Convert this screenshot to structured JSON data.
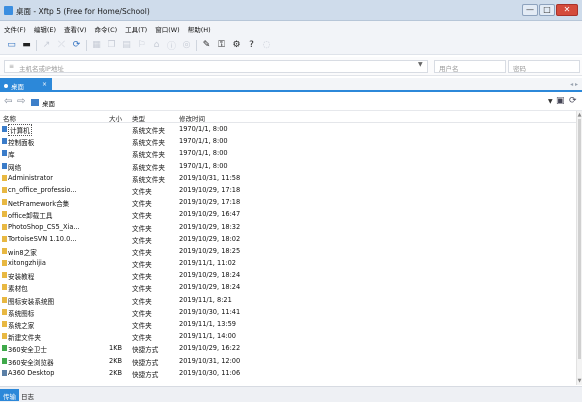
{
  "window": {
    "title": "桌面 - Xftp 5 (Free for Home/School)",
    "btn_min": "—",
    "btn_max": "□",
    "btn_close": "✕"
  },
  "menu": [
    "文件(F)",
    "编辑(E)",
    "查看(V)",
    "命令(C)",
    "工具(T)",
    "窗口(W)",
    "帮助(H)"
  ],
  "address": {
    "placeholder": "主机名或IP地址",
    "username_placeholder": "用户名",
    "password_placeholder": "密码"
  },
  "tab": {
    "label": "桌面",
    "close": "×"
  },
  "path": {
    "location": "桌面"
  },
  "columns": {
    "name": "名称",
    "size": "大小",
    "type": "类型",
    "date": "修改时间"
  },
  "files": [
    {
      "name": "计算机",
      "size": "",
      "type": "系统文件夹",
      "date": "1970/1/1, 8:00",
      "icon_color": "#3a7cc9"
    },
    {
      "name": "控制面板",
      "size": "",
      "type": "系统文件夹",
      "date": "1970/1/1, 8:00",
      "icon_color": "#3a7cc9"
    },
    {
      "name": "库",
      "size": "",
      "type": "系统文件夹",
      "date": "1970/1/1, 8:00",
      "icon_color": "#3a7cc9"
    },
    {
      "name": "网络",
      "size": "",
      "type": "系统文件夹",
      "date": "1970/1/1, 8:00",
      "icon_color": "#3a7cc9"
    },
    {
      "name": "Administrator",
      "size": "",
      "type": "系统文件夹",
      "date": "2019/10/31, 11:58",
      "icon_color": "#e8b842"
    },
    {
      "name": "cn_office_professio...",
      "size": "",
      "type": "文件夹",
      "date": "2019/10/29, 17:18",
      "icon_color": "#e8b842"
    },
    {
      "name": "NetFramework合集",
      "size": "",
      "type": "文件夹",
      "date": "2019/10/29, 17:18",
      "icon_color": "#e8b842"
    },
    {
      "name": "office卸载工具",
      "size": "",
      "type": "文件夹",
      "date": "2019/10/29, 16:47",
      "icon_color": "#e8b842"
    },
    {
      "name": "PhotoShop_CS5_Xia...",
      "size": "",
      "type": "文件夹",
      "date": "2019/10/29, 18:32",
      "icon_color": "#e8b842"
    },
    {
      "name": "TortoiseSVN 1.10.0...",
      "size": "",
      "type": "文件夹",
      "date": "2019/10/29, 18:02",
      "icon_color": "#e8b842"
    },
    {
      "name": "win8之家",
      "size": "",
      "type": "文件夹",
      "date": "2019/10/29, 18:25",
      "icon_color": "#e8b842"
    },
    {
      "name": "xitongzhijia",
      "size": "",
      "type": "文件夹",
      "date": "2019/11/1, 11:02",
      "icon_color": "#e8b842"
    },
    {
      "name": "安装教程",
      "size": "",
      "type": "文件夹",
      "date": "2019/10/29, 18:24",
      "icon_color": "#e8b842"
    },
    {
      "name": "素材包",
      "size": "",
      "type": "文件夹",
      "date": "2019/10/29, 18:24",
      "icon_color": "#e8b842"
    },
    {
      "name": "图标安装系统图",
      "size": "",
      "type": "文件夹",
      "date": "2019/11/1, 8:21",
      "icon_color": "#e8b842"
    },
    {
      "name": "系统图标",
      "size": "",
      "type": "文件夹",
      "date": "2019/10/30, 11:41",
      "icon_color": "#e8b842"
    },
    {
      "name": "系统之家",
      "size": "",
      "type": "文件夹",
      "date": "2019/11/1, 13:59",
      "icon_color": "#e8b842"
    },
    {
      "name": "新建文件夹",
      "size": "",
      "type": "文件夹",
      "date": "2019/11/1, 14:00",
      "icon_color": "#e8b842"
    },
    {
      "name": "360安全卫士",
      "size": "1KB",
      "type": "快捷方式",
      "date": "2019/10/29, 16:22",
      "icon_color": "#3fa94a"
    },
    {
      "name": "360安全浏览器",
      "size": "2KB",
      "type": "快捷方式",
      "date": "2019/10/31, 12:00",
      "icon_color": "#3fa94a"
    },
    {
      "name": "A360 Desktop",
      "size": "2KB",
      "type": "快捷方式",
      "date": "2019/10/30, 11:06",
      "icon_color": "#5b7fa6"
    }
  ],
  "bottom_tabs": [
    "传输",
    "日志"
  ]
}
